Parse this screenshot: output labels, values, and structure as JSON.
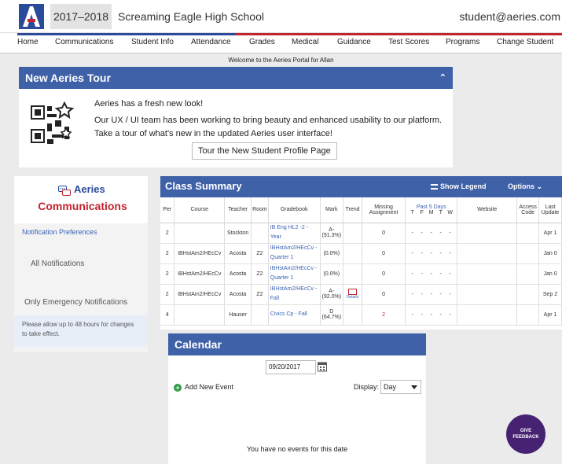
{
  "header": {
    "year": "2017–2018",
    "school": "Screaming Eagle High School",
    "user": "student@aeries.com"
  },
  "nav": [
    {
      "label": "Home"
    },
    {
      "label": "Communications"
    },
    {
      "label": "Student Info"
    },
    {
      "label": "Attendance"
    },
    {
      "label": "Grades"
    },
    {
      "label": "Medical"
    },
    {
      "label": "Guidance"
    },
    {
      "label": "Test Scores"
    },
    {
      "label": "Programs"
    },
    {
      "label": "Change Student"
    }
  ],
  "welcome": "Welcome to the Aeries Portal for Allan",
  "tour": {
    "title": "New Aeries Tour",
    "line1": "Aeries has a fresh new look!",
    "line2": "Our UX / UI team has been working to bring beauty and enhanced usability to our platform. Take a tour of what's new in the updated Aeries user interface!",
    "button": "Tour the New Student Profile Page"
  },
  "communications": {
    "brand": "Aeries",
    "title": "Communications",
    "pref_link": "Notification Preferences",
    "all": "All Notifications",
    "emergency": "Only Emergency Notifications",
    "note": "Please allow up to 48 hours for changes to take effect."
  },
  "class_summary": {
    "title": "Class Summary",
    "legend": "Show Legend",
    "options": "Options",
    "headers": {
      "per": "Per",
      "course": "Course",
      "teacher": "Teacher",
      "room": "Room",
      "gradebook": "Gradebook",
      "mark": "Mark",
      "trend": "Trend",
      "missing": "Missing Assignment",
      "past5": "Past 5 Days",
      "days": [
        "T",
        "F",
        "M",
        "T",
        "W"
      ],
      "website": "Website",
      "access": "Access Code",
      "last": "Last Update"
    },
    "rows": [
      {
        "per": "2",
        "course": "",
        "teacher": "Stockton",
        "room": "",
        "gradebook": "IB Eng HL2 -2 - Year",
        "mark": "A-",
        "pct": "(91.3%)",
        "trend": "",
        "missing": "0",
        "last": "Apr 1"
      },
      {
        "per": "2",
        "course": "IBHstAm2/HEcCv",
        "teacher": "Acosta",
        "room": "Z2",
        "gradebook": "IBHstAm2/HEcCv - Quarter 1",
        "mark": "",
        "pct": "(0.0%)",
        "trend": "",
        "missing": "0",
        "last": "Jan 0"
      },
      {
        "per": "2",
        "course": "IBHstAm2/HEcCv",
        "teacher": "Acosta",
        "room": "Z2",
        "gradebook": "IBHstAm2/HEcCv - Quarter 1",
        "mark": "",
        "pct": "(0.0%)",
        "trend": "",
        "missing": "0",
        "last": "Jan 0"
      },
      {
        "per": "2",
        "course": "IBHstAm2/HEcCv",
        "teacher": "Acosta",
        "room": "Z2",
        "gradebook": "IBHstAm2/HEcCv - Fall",
        "mark": "A-",
        "pct": "(92.0%)",
        "trend": "Details",
        "missing": "0",
        "last": "Sep 2"
      },
      {
        "per": "4",
        "course": "",
        "teacher": "Hauser",
        "room": "",
        "gradebook": "Civics Cp - Fall",
        "mark": "D",
        "pct": "(64.7%)",
        "trend": "",
        "missing": "2",
        "last": "Apr 1"
      }
    ],
    "day_placeholder": "-"
  },
  "calendar": {
    "title": "Calendar",
    "date": "09/20/2017",
    "add": "Add New Event",
    "display_label": "Display:",
    "display_value": "Day",
    "empty": "You have no events for this date"
  },
  "feedback": {
    "line1": "GIVE",
    "line2": "FEEDBACK"
  },
  "colors": {
    "primary": "#3f61a8",
    "accent": "#c2252f",
    "link": "#3a62b2",
    "feedback": "#472273"
  }
}
